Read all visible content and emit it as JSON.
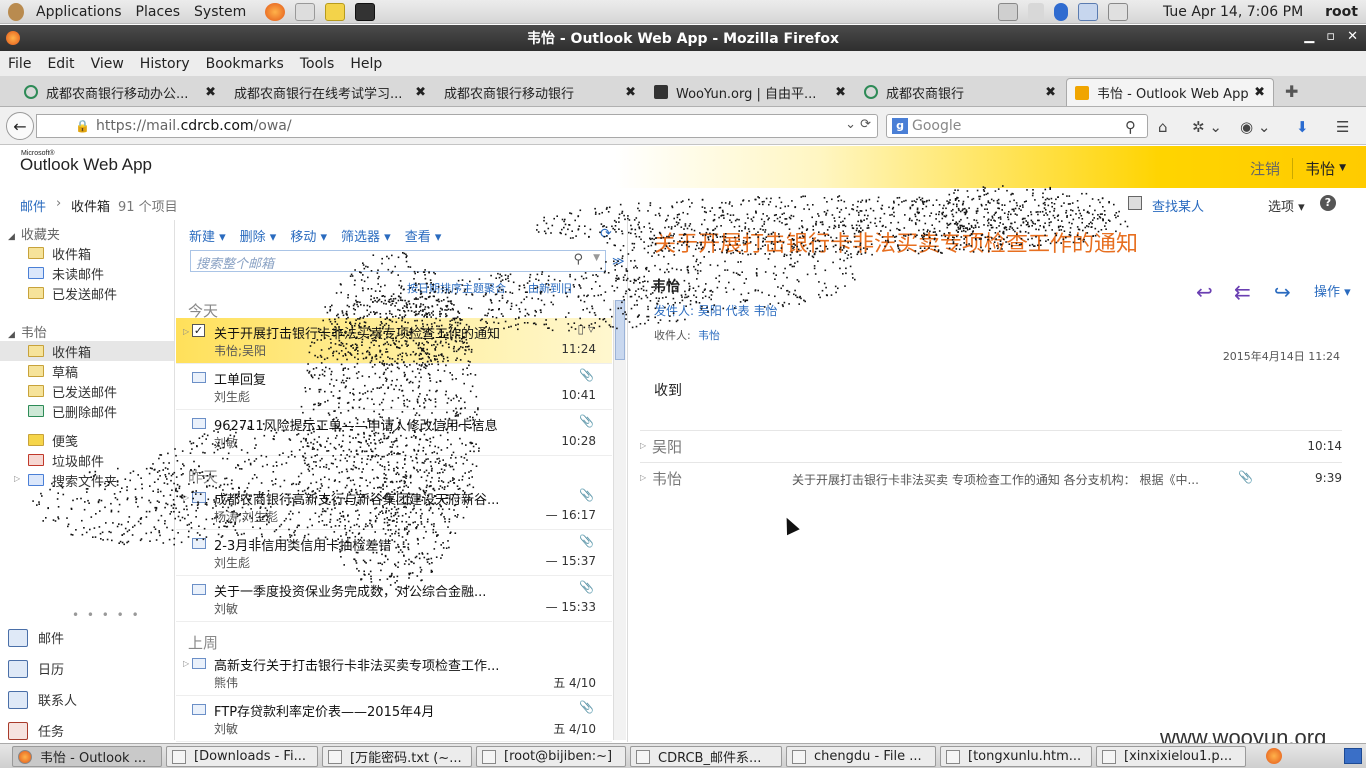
{
  "panel": {
    "menus": [
      "Applications",
      "Places",
      "System"
    ],
    "clock": "Tue Apr 14,  7:06 PM",
    "user": "root"
  },
  "window": {
    "title": "韦怡 - Outlook Web App - Mozilla Firefox"
  },
  "menubar": [
    "File",
    "Edit",
    "View",
    "History",
    "Bookmarks",
    "Tools",
    "Help"
  ],
  "tabs": [
    {
      "label": "成都农商银行移动办公...",
      "color": "#2e8b57"
    },
    {
      "label": "成都农商银行在线考试学习...",
      "color": ""
    },
    {
      "label": "成都农商银行移动银行",
      "color": ""
    },
    {
      "label": "WooYun.org | 自由平...",
      "color": "#333333"
    },
    {
      "label": "成都农商银行",
      "color": "#2e8b57"
    },
    {
      "label": "韦怡 - Outlook Web App",
      "color": "#f0a500"
    }
  ],
  "urlbar": {
    "scheme": "https://mail.",
    "host": "cdrcb.com",
    "path": "/owa/"
  },
  "search": {
    "engine": "g",
    "placeholder": "Google"
  },
  "owa": {
    "logo_small": "Microsoft®",
    "logo": "Outlook Web App",
    "signout": "注销",
    "username": "韦怡"
  },
  "breadcrumb": {
    "mail": "邮件",
    "sep": "›",
    "folder": "收件箱",
    "count": "91 个项目",
    "find_people": "查找某人",
    "options": "选项 ▾",
    "help": "?"
  },
  "leftnav": {
    "favorites": "收藏夹",
    "fav_items": [
      "收件箱",
      "未读邮件",
      "已发送邮件"
    ],
    "mailbox": "韦怡",
    "mb_items": [
      "收件箱",
      "草稿",
      "已发送邮件",
      "已删除邮件"
    ],
    "other_items": [
      "便笺",
      "垃圾邮件",
      "搜索文件夹"
    ],
    "dots": "• • • • •",
    "modules": [
      "邮件",
      "日历",
      "联系人",
      "任务"
    ]
  },
  "list": {
    "toolbar": [
      "新建 ▾",
      "删除 ▾",
      "移动 ▾",
      "筛选器 ▾",
      "查看 ▾"
    ],
    "refresh": "⟳",
    "search_placeholder": "搜索整个邮箱",
    "expander": "≫",
    "sort_by": "按日期排序主题聚合",
    "sort_order": "由新到旧",
    "groups": [
      "今天",
      "昨天",
      "上周"
    ],
    "items": [
      {
        "subject": "关于开展打击银行卡非法买卖专项检查工作的通知",
        "from": "韦怡;吴阳",
        "time": "11:24",
        "attach": ""
      },
      {
        "subject": "工单回复",
        "from": "刘生彪",
        "time": "10:41",
        "attach": "📎"
      },
      {
        "subject": "962711风险提示工单——申请人修改信用卡信息",
        "from": "刘敏",
        "time": "10:28",
        "attach": "📎"
      },
      {
        "subject": "成都农商银行高新支行与新谷集团建设天府新谷...",
        "from": "杨涛;刘生彪",
        "time": "— 16:17",
        "attach": "📎"
      },
      {
        "subject": "2-3月非信用类信用卡抽检差错",
        "from": "刘生彪",
        "time": "— 15:37",
        "attach": "📎"
      },
      {
        "subject": "关于一季度投资保业务完成数，对公综合金融...",
        "from": "刘敏",
        "time": "— 15:33",
        "attach": "📎"
      },
      {
        "subject": "高新支行关于打击银行卡非法买卖专项检查工作...",
        "from": "熊伟",
        "time": "五 4/10",
        "attach": ""
      },
      {
        "subject": "FTP存贷款利率定价表——2015年4月",
        "from": "刘敏",
        "time": "五 4/10",
        "attach": "📎"
      }
    ]
  },
  "reading": {
    "subject": "关于开展打击银行卡非法买卖专项检查工作的通知",
    "sender": "韦怡",
    "from_line": "发件人: 吴阳 代表 韦怡",
    "to_label": "收件人:",
    "to": "韦怡",
    "actions_label": "操作 ▾",
    "date": "2015年4月14日 11:24",
    "body": "收到",
    "thread": [
      {
        "name": "吴阳",
        "preview": "",
        "attach": "",
        "time": "10:14"
      },
      {
        "name": "韦怡",
        "preview": "关于开展打击银行卡非法买卖 专项检查工作的通知 各分支机构： 根据《中...",
        "attach": "📎",
        "time": "9:39"
      }
    ]
  },
  "taskbar": [
    "韦怡 - Outlook ...",
    "[Downloads - Fi...",
    "[万能密码.txt (~...",
    "[root@bijiben:~]",
    "CDRCB_邮件系...",
    "chengdu - File ...",
    "[tongxunlu.htm...",
    "[xinxixielou1.p..."
  ],
  "watermark": "www.wooyun.org",
  "colors": {
    "accent": "#e76f20",
    "link": "#2a6bbf",
    "header_yellow": "#ffd400"
  }
}
